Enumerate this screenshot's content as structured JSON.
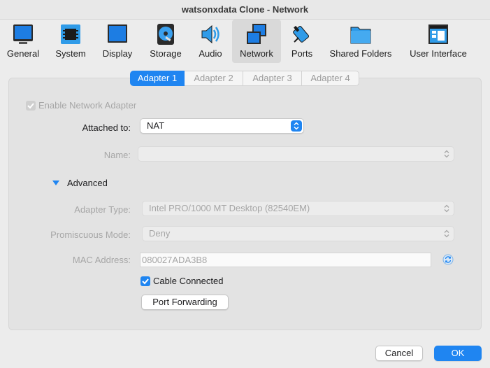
{
  "window": {
    "title": "watsonxdata Clone - Network"
  },
  "toolbar": {
    "items": [
      {
        "label": "General",
        "icon": "general-icon"
      },
      {
        "label": "System",
        "icon": "chip-icon"
      },
      {
        "label": "Display",
        "icon": "monitor-icon"
      },
      {
        "label": "Storage",
        "icon": "disk-icon"
      },
      {
        "label": "Audio",
        "icon": "speaker-icon"
      },
      {
        "label": "Network",
        "icon": "network-icon",
        "selected": true
      },
      {
        "label": "Ports",
        "icon": "port-icon"
      },
      {
        "label": "Shared Folders",
        "icon": "folder-icon"
      },
      {
        "label": "User Interface",
        "icon": "window-icon"
      }
    ]
  },
  "tabs": [
    {
      "label": "Adapter 1",
      "selected": true
    },
    {
      "label": "Adapter 2"
    },
    {
      "label": "Adapter 3"
    },
    {
      "label": "Adapter 4"
    }
  ],
  "form": {
    "enable_adapter": {
      "label": "Enable Network Adapter",
      "checked": true,
      "enabled": false
    },
    "attached_to": {
      "label": "Attached to:",
      "value": "NAT"
    },
    "name": {
      "label": "Name:",
      "value": ""
    },
    "advanced": {
      "label": "Advanced",
      "expanded": true
    },
    "adapter_type": {
      "label": "Adapter Type:",
      "value": "Intel PRO/1000 MT Desktop (82540EM)"
    },
    "promiscuous_mode": {
      "label": "Promiscuous Mode:",
      "value": "Deny"
    },
    "mac_address": {
      "label": "MAC Address:",
      "value": "080027ADA3B8"
    },
    "cable_connected": {
      "label": "Cable Connected",
      "checked": true
    },
    "port_forwarding": {
      "label": "Port Forwarding"
    }
  },
  "footer": {
    "cancel_label": "Cancel",
    "ok_label": "OK"
  },
  "colors": {
    "accent": "#1f85f1",
    "disabled_text": "#a6a6a6"
  }
}
